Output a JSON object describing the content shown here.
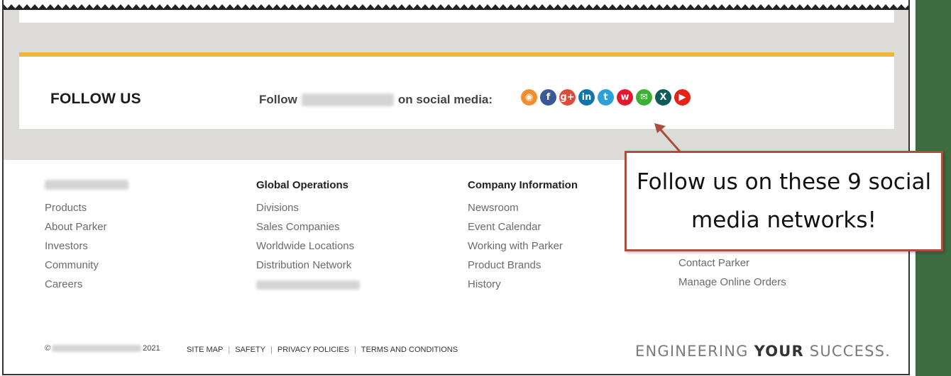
{
  "follow": {
    "title": "FOLLOW US",
    "prefix": "Follow",
    "suffix": "on social media:",
    "icons": [
      {
        "name": "rss-icon",
        "glyph": "◉",
        "color": "#f28f2d"
      },
      {
        "name": "facebook-icon",
        "glyph": "f",
        "color": "#3b5998"
      },
      {
        "name": "google-plus-icon",
        "glyph": "g+",
        "color": "#dd4b39"
      },
      {
        "name": "linkedin-icon",
        "glyph": "in",
        "color": "#0e76a8"
      },
      {
        "name": "twitter-icon",
        "glyph": "t",
        "color": "#2ea0d8"
      },
      {
        "name": "weibo-icon",
        "glyph": "w",
        "color": "#e6162d"
      },
      {
        "name": "wechat-icon",
        "glyph": "✉",
        "color": "#3cb034"
      },
      {
        "name": "xing-icon",
        "glyph": "X",
        "color": "#0b5c5b"
      },
      {
        "name": "youtube-icon",
        "glyph": "▶",
        "color": "#e62117"
      }
    ]
  },
  "footer": {
    "col1": {
      "items": [
        "Products",
        "About Parker",
        "Investors",
        "Community",
        "Careers"
      ]
    },
    "col2": {
      "heading": "Global Operations",
      "items": [
        "Divisions",
        "Sales Companies",
        "Worldwide Locations",
        "Distribution Network"
      ]
    },
    "col3": {
      "heading": "Company Information",
      "items": [
        "Newsroom",
        "Event Calendar",
        "Working with Parker",
        "Product Brands",
        "History"
      ]
    },
    "col4": {
      "items": [
        "Contact Parker",
        "Manage Online Orders"
      ]
    }
  },
  "bottom": {
    "copyright_symbol": "©",
    "year": "2021",
    "links": [
      "SITE MAP",
      "SAFETY",
      "PRIVACY POLICIES",
      "TERMS AND CONDITIONS"
    ],
    "tagline_a": "ENGINEERING",
    "tagline_b": "YOUR",
    "tagline_c": "SUCCESS."
  },
  "callout": {
    "text": "Follow us on these 9 social media networks!",
    "border_color": "#a94f3f"
  },
  "colors": {
    "accent_bar": "#f2b33d",
    "gray_band": "#dcdbd7"
  }
}
